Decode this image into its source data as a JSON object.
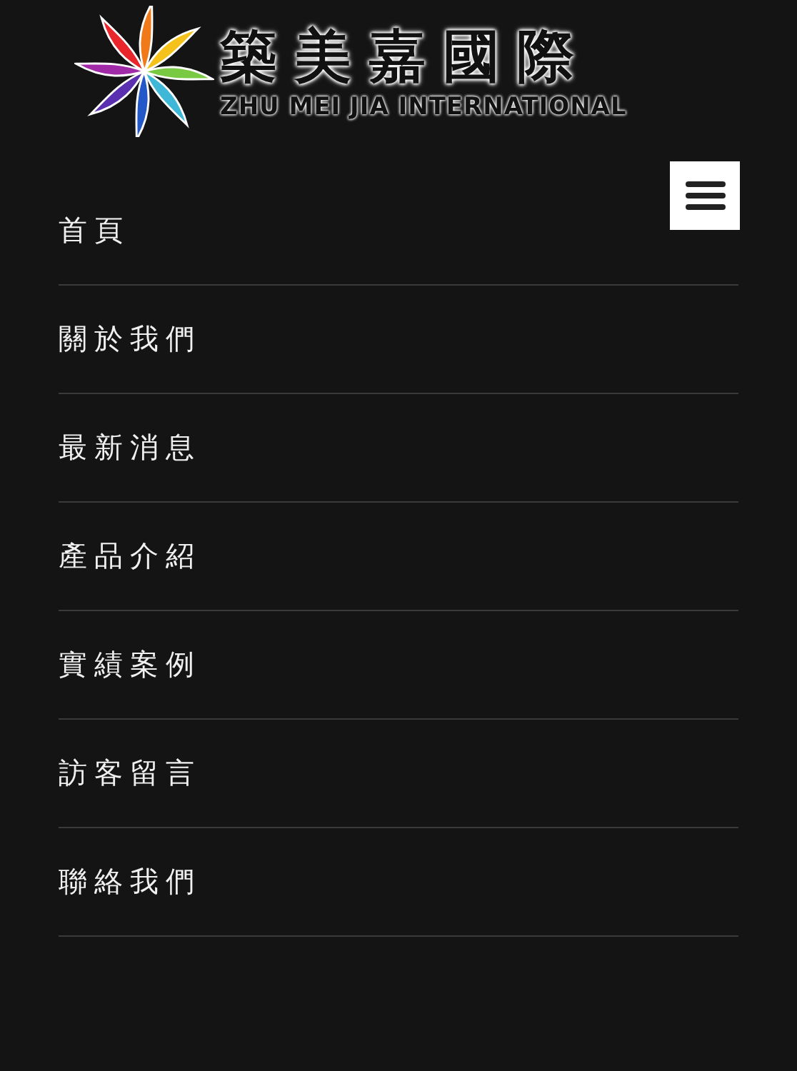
{
  "logo": {
    "title": "築美嘉國際",
    "subtitle": "ZHU MEI JIA INTERNATIONAL"
  },
  "menu": {
    "items": [
      {
        "label": "首頁"
      },
      {
        "label": "關於我們"
      },
      {
        "label": "最新消息"
      },
      {
        "label": "產品介紹"
      },
      {
        "label": "實績案例"
      },
      {
        "label": "訪客留言"
      },
      {
        "label": "聯絡我們"
      }
    ]
  }
}
